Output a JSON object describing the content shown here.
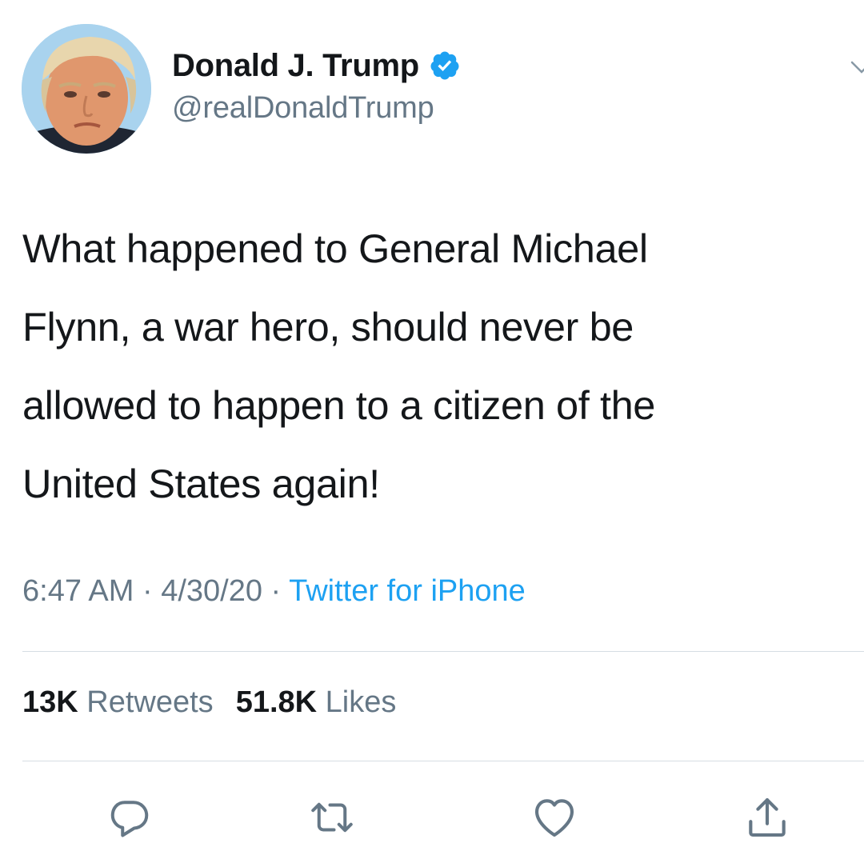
{
  "user": {
    "display_name": "Donald J. Trump",
    "handle": "@realDonaldTrump",
    "verified": true
  },
  "tweet": {
    "lines": [
      "What happened to General Michael",
      "Flynn, a war hero, should never be",
      "allowed to happen to a citizen of the",
      "United States again!"
    ],
    "time": "6:47 AM",
    "date": "4/30/20",
    "separator": " · ",
    "source": "Twitter for iPhone"
  },
  "stats": {
    "retweets_count": "13K",
    "retweets_label": "Retweets",
    "likes_count": "51.8K",
    "likes_label": "Likes"
  },
  "icons": {
    "verified": "verified-badge-icon",
    "more": "chevron-down-icon",
    "reply": "reply-icon",
    "retweet": "retweet-icon",
    "like": "heart-icon",
    "share": "share-icon"
  },
  "colors": {
    "text": "#14171a",
    "secondary": "#657786",
    "accent": "#1da1f2",
    "divider": "#d6dde3"
  }
}
